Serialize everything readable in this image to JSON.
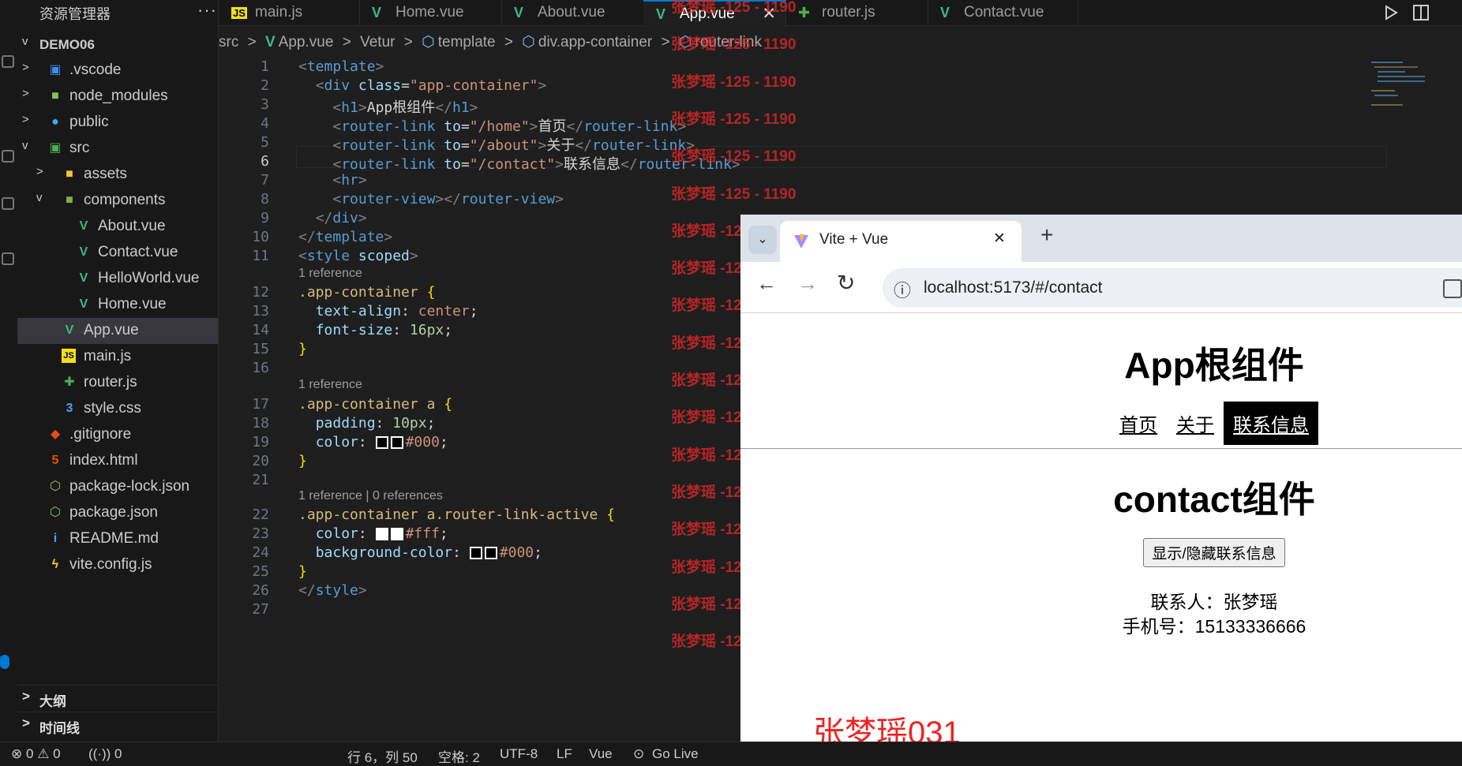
{
  "explorer": {
    "title": "资源管理器",
    "more": "···",
    "project": "DEMO06",
    "items": [
      {
        "label": ".vscode",
        "icon": "vscode-folder-icon",
        "depth": 1,
        "chevron": ">",
        "sym": "▣",
        "color": "#3b8eea"
      },
      {
        "label": "node_modules",
        "icon": "node-folder-icon",
        "depth": 1,
        "chevron": ">",
        "sym": "■",
        "color": "#8bc34a"
      },
      {
        "label": "public",
        "icon": "globe-folder-icon",
        "depth": 1,
        "chevron": ">",
        "sym": "●",
        "color": "#42a5f5"
      },
      {
        "label": "src",
        "icon": "src-folder-icon",
        "depth": 1,
        "chevron": "v",
        "sym": "▣",
        "color": "#4caf50"
      },
      {
        "label": "assets",
        "icon": "assets-folder-icon",
        "depth": 2,
        "chevron": ">",
        "sym": "■",
        "color": "#fbc02d"
      },
      {
        "label": "components",
        "icon": "components-folder-icon",
        "depth": 2,
        "chevron": "v",
        "sym": "■",
        "color": "#7cb342"
      },
      {
        "label": "About.vue",
        "icon": "vue-file-icon",
        "depth": 3,
        "chevron": "",
        "sym": "V",
        "color": "#41b883"
      },
      {
        "label": "Contact.vue",
        "icon": "vue-file-icon",
        "depth": 3,
        "chevron": "",
        "sym": "V",
        "color": "#41b883"
      },
      {
        "label": "HelloWorld.vue",
        "icon": "vue-file-icon",
        "depth": 3,
        "chevron": "",
        "sym": "V",
        "color": "#41b883"
      },
      {
        "label": "Home.vue",
        "icon": "vue-file-icon",
        "depth": 3,
        "chevron": "",
        "sym": "V",
        "color": "#41b883"
      },
      {
        "label": "App.vue",
        "icon": "vue-file-icon",
        "depth": 2,
        "chevron": "",
        "sym": "V",
        "color": "#41b883",
        "selected": true
      },
      {
        "label": "main.js",
        "icon": "js-file-icon",
        "depth": 2,
        "chevron": "",
        "sym": "JS",
        "color": "#f5de19"
      },
      {
        "label": "router.js",
        "icon": "router-file-icon",
        "depth": 2,
        "chevron": "",
        "sym": "✚",
        "color": "#4caf50"
      },
      {
        "label": "style.css",
        "icon": "css-file-icon",
        "depth": 2,
        "chevron": "",
        "sym": "3",
        "color": "#42a5f5"
      },
      {
        "label": ".gitignore",
        "icon": "git-file-icon",
        "depth": 1,
        "chevron": "",
        "sym": "◆",
        "color": "#e64a19"
      },
      {
        "label": "index.html",
        "icon": "html-file-icon",
        "depth": 1,
        "chevron": "",
        "sym": "5",
        "color": "#e65100"
      },
      {
        "label": "package-lock.json",
        "icon": "node-json-icon",
        "depth": 1,
        "chevron": "",
        "sym": "⬡",
        "color": "#8bc34a"
      },
      {
        "label": "package.json",
        "icon": "node-json-icon",
        "depth": 1,
        "chevron": "",
        "sym": "⬡",
        "color": "#8bc34a"
      },
      {
        "label": "README.md",
        "icon": "info-file-icon",
        "depth": 1,
        "chevron": "",
        "sym": "i",
        "color": "#42a5f5"
      },
      {
        "label": "vite.config.js",
        "icon": "vite-file-icon",
        "depth": 1,
        "chevron": "",
        "sym": "ϟ",
        "color": "#ffca28"
      }
    ],
    "outline": "大纲",
    "timeline": "时间线"
  },
  "tabs": [
    {
      "label": "main.js",
      "sym": "JS",
      "color": "#f5de19"
    },
    {
      "label": "Home.vue",
      "sym": "V",
      "color": "#41b883"
    },
    {
      "label": "About.vue",
      "sym": "V",
      "color": "#41b883"
    },
    {
      "label": "App.vue",
      "sym": "V",
      "color": "#41b883",
      "active": true
    },
    {
      "label": "router.js",
      "sym": "✚",
      "color": "#4caf50"
    },
    {
      "label": "Contact.vue",
      "sym": "V",
      "color": "#41b883"
    }
  ],
  "tab_close": "✕",
  "breadcrumb": [
    "src",
    ">",
    "App.vue",
    ">",
    "Vetur",
    ">",
    "template",
    ">",
    "div.app-container",
    ">",
    "router-link"
  ],
  "codelens": {
    "l11": "1 reference",
    "l16": "1 reference",
    "l21": "1 reference | 0 references"
  },
  "status": {
    "problems": "⊗ 0 ⚠ 0",
    "ports": "((·)) 0",
    "position": "行 6，列 50",
    "spaces": "空格: 2",
    "encoding": "UTF-8",
    "eol": "LF",
    "language": "Vue",
    "golive": "Go Live"
  },
  "watermark": {
    "text": "张梦瑶 -125 - 1190",
    "signature": "张梦瑶031"
  },
  "browser": {
    "tab_title": "Vite + Vue",
    "tab_close": "✕",
    "new_tab": "+",
    "tab_menu": "⌄",
    "back": "←",
    "forward": "→",
    "reload": "↻",
    "info": "ⓘ",
    "url": "localhost:5173/#/contact",
    "heading": "App根组件",
    "nav": [
      "首页",
      "关于",
      "联系信息"
    ],
    "sub_heading": "contact组件",
    "toggle_button": "显示/隐藏联系信息",
    "contact_name": "联系人：张梦瑶",
    "contact_phone": "手机号：15133336666"
  }
}
